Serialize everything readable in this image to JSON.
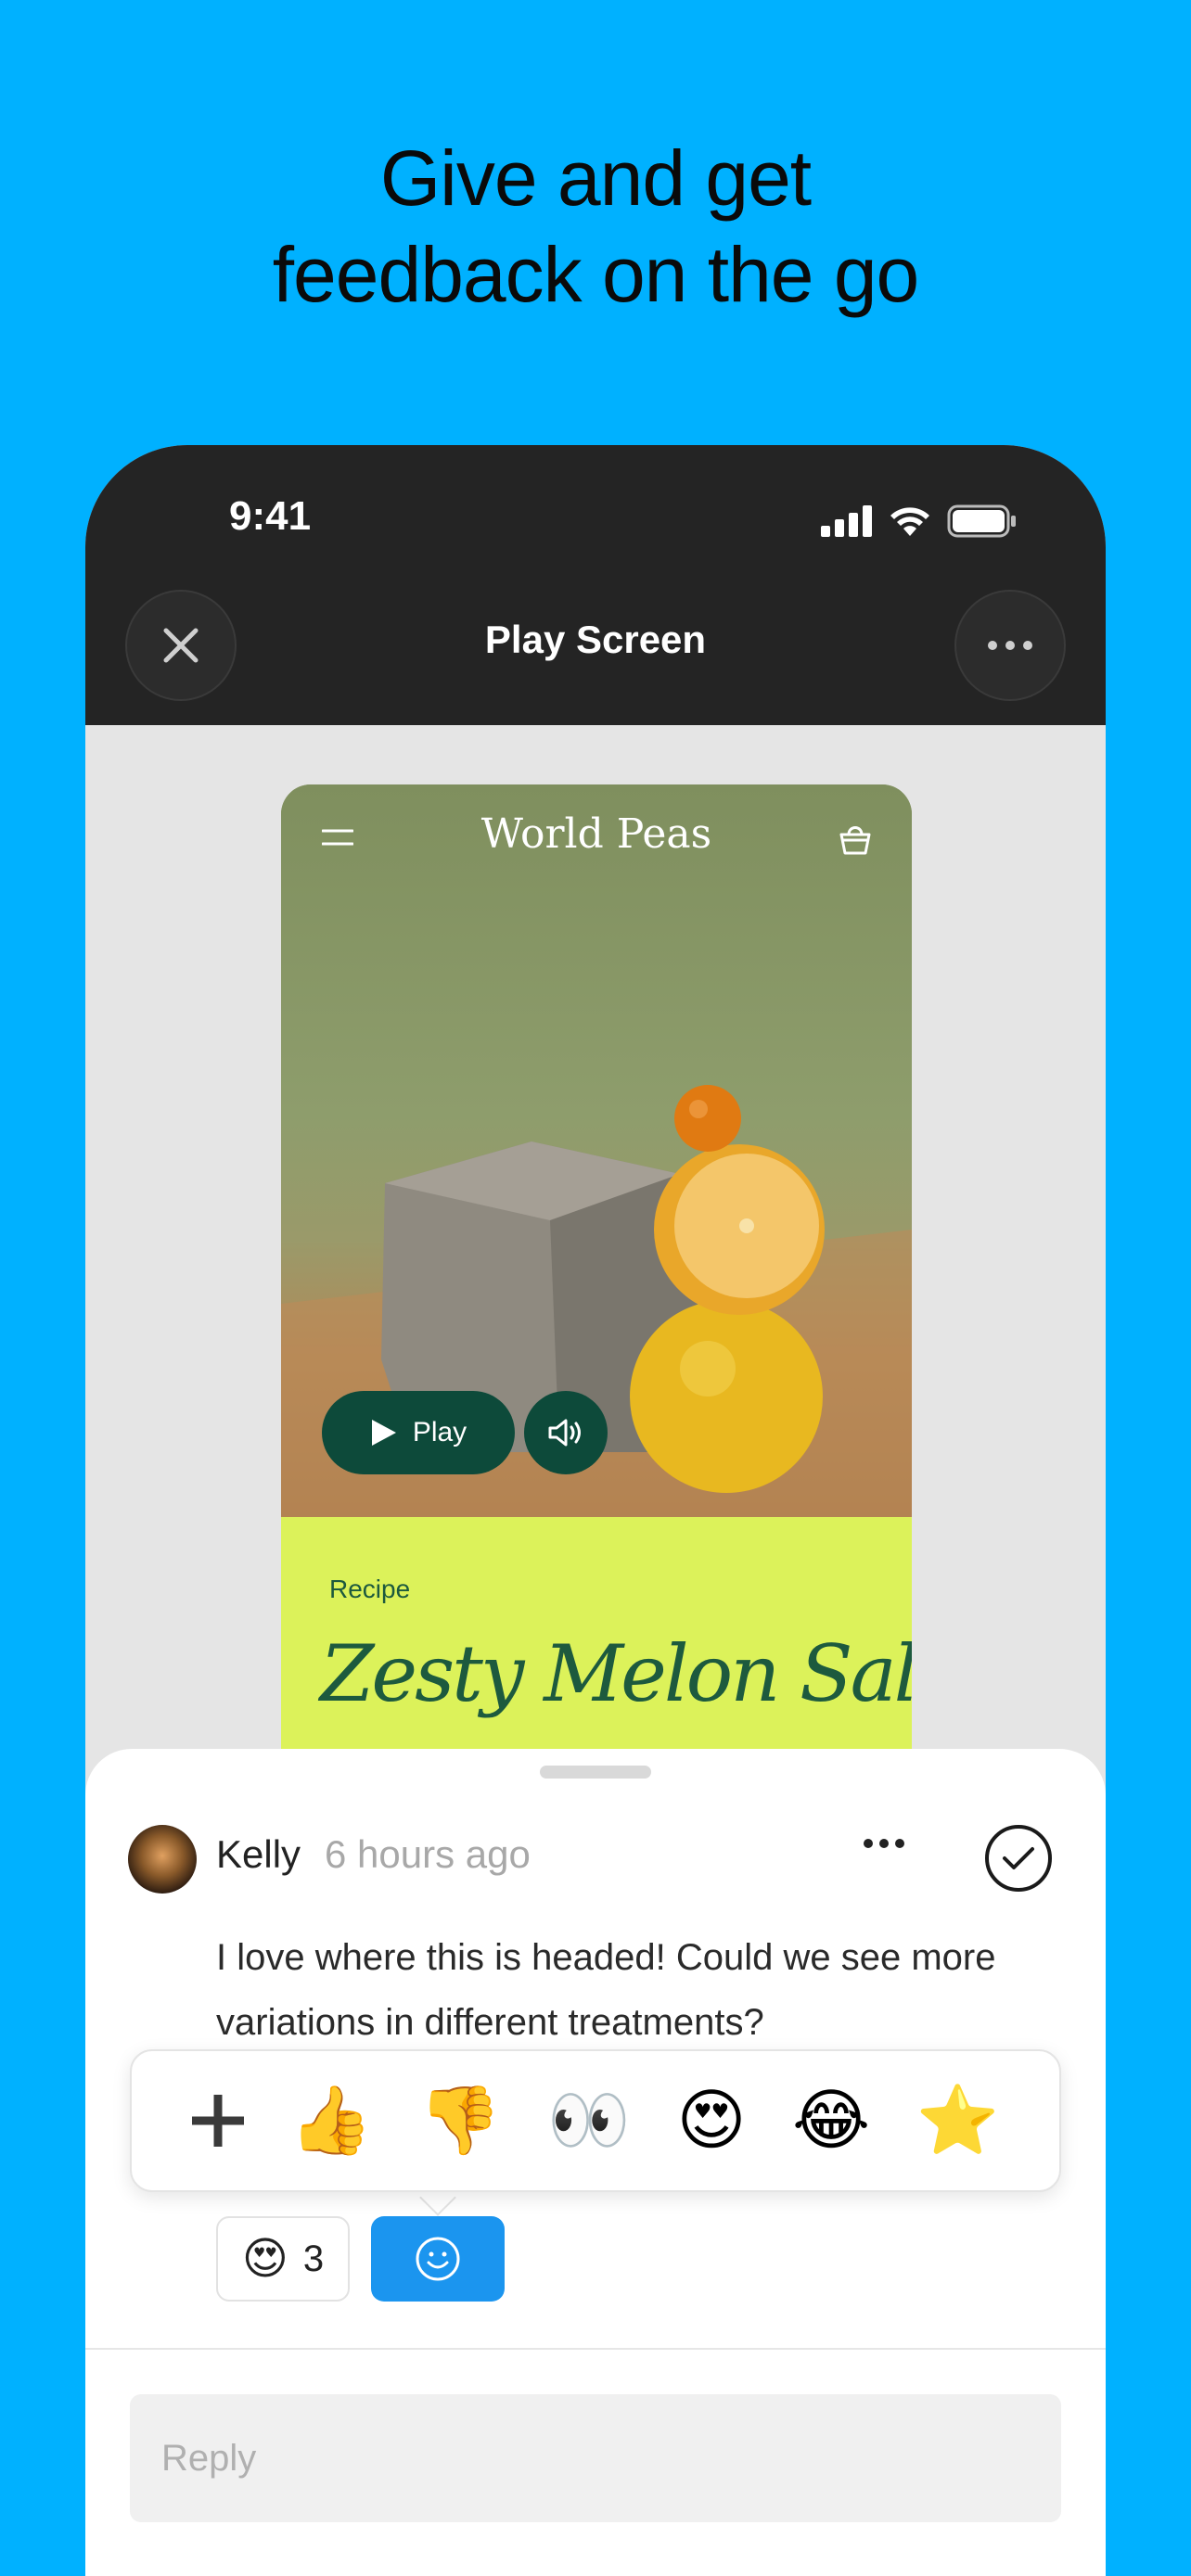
{
  "headline": {
    "line1": "Give and get",
    "line2": "feedback on the go"
  },
  "status_bar": {
    "time": "9:41",
    "icons": [
      "signal-icon",
      "wifi-icon",
      "battery-icon"
    ]
  },
  "nav": {
    "title": "Play Screen",
    "left_icon": "close-icon",
    "right_icon": "more-icon"
  },
  "mock_app": {
    "brand": "World Peas",
    "menu_icon": "hamburger-icon",
    "bag_icon": "basket-icon",
    "play_label": "Play",
    "sound_icon": "speaker-icon",
    "recipe_label": "Recipe",
    "recipe_title": "Zesty Melon Salsa"
  },
  "comment": {
    "author": "Kelly",
    "timestamp": "6 hours ago",
    "text": "I love where this is headed! Could we see more variations in different treatments?",
    "more_icon": "more-icon",
    "resolve_icon": "check-circle-icon"
  },
  "reaction_picker": {
    "add_label": "+",
    "emojis": [
      "👍",
      "👎",
      "👀",
      "😍",
      "😂",
      "⭐"
    ]
  },
  "reactions": [
    {
      "emoji": "😍",
      "count": "3"
    }
  ],
  "add_reaction_icon": "smiley-icon",
  "reply": {
    "placeholder": "Reply",
    "value": ""
  },
  "colors": {
    "background": "#00b1ff",
    "accent": "#1b95ef",
    "recipe_bg": "#dcf25a",
    "recipe_text": "#1d5a3e"
  }
}
